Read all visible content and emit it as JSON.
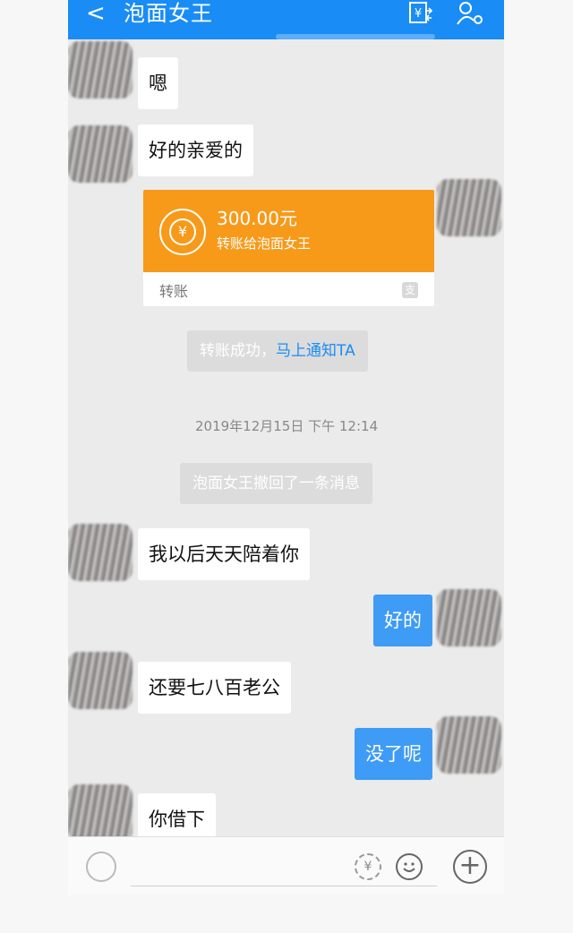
{
  "header": {
    "back_glyph": "<",
    "title": "泡面女王",
    "bill_icon": "bill-exchange-icon",
    "settings_icon": "user-settings-icon",
    "color": "#1a8cf5"
  },
  "messages": [
    {
      "side": "left",
      "text": "嗯"
    },
    {
      "side": "left",
      "text": "好的亲爱的"
    }
  ],
  "transfer": {
    "amount": "300.00元",
    "description": "转账给泡面女王",
    "footer": "转账",
    "mark": "支",
    "color": "#f79a1a"
  },
  "system": {
    "transfer_done_prefix": "转账成功，",
    "transfer_done_link": "马上通知TA",
    "timestamp": "2019年12月15日 下午 12:14",
    "recalled": "泡面女王撤回了一条消息"
  },
  "later_messages": [
    {
      "side": "left",
      "text": "我以后天天陪着你"
    },
    {
      "side": "right",
      "text": "好的"
    },
    {
      "side": "left",
      "text": "还要七八百老公"
    },
    {
      "side": "right",
      "text": "没了呢"
    },
    {
      "side": "left",
      "text": "你借下"
    }
  ],
  "input_bar": {
    "rmb_glyph": "¥",
    "plus_glyph": "+",
    "icons": [
      "voice-icon",
      "red-packet-icon",
      "emoji-icon",
      "plus-icon"
    ]
  }
}
